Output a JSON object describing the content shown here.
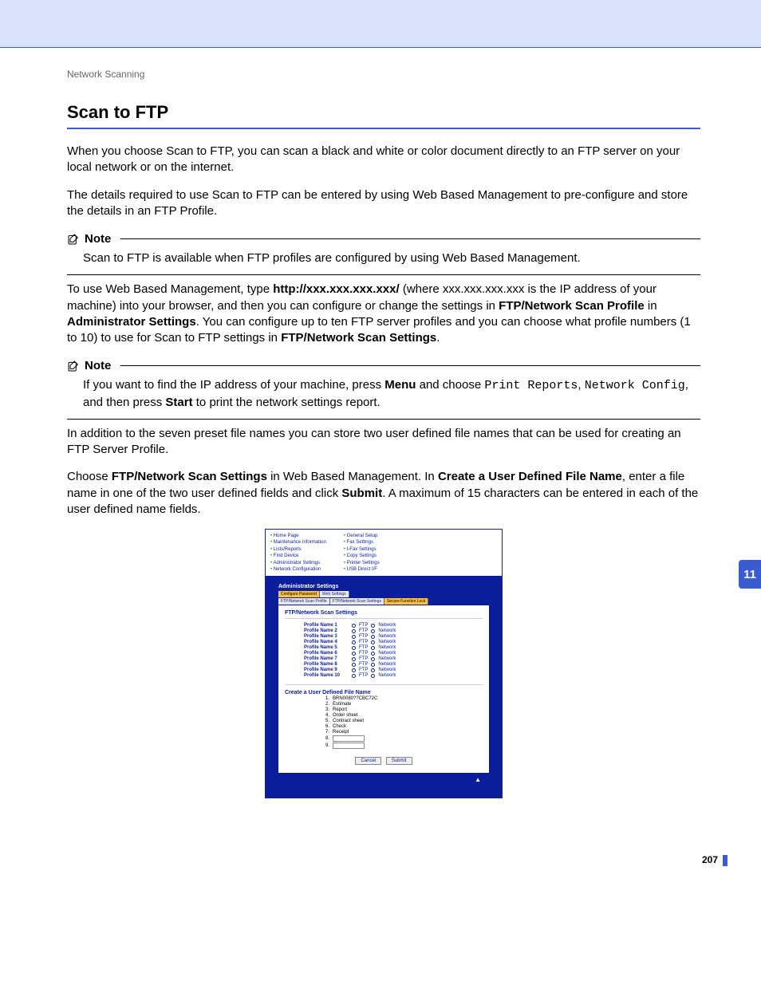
{
  "breadcrumb": "Network Scanning",
  "title": "Scan to FTP",
  "side_tab": "11",
  "page_number": "207",
  "p1": "When you choose Scan to FTP, you can scan a black and white or color document directly to an FTP server on your local network or on the internet.",
  "p2": "The details required to use Scan to FTP can be entered by using Web Based Management to pre-configure and store the details in an FTP Profile.",
  "note1": {
    "label": "Note",
    "body": "Scan to FTP is available when FTP profiles are configured by using Web Based Management."
  },
  "p3a": "To use Web Based Management, type ",
  "p3_url": "http://xxx.xxx.xxx.xxx/",
  "p3b": " (where xxx.xxx.xxx.xxx is the IP address of your machine) into your browser, and then you can configure or change the settings in ",
  "p3_b1": "FTP/Network Scan Profile",
  "p3c": " in ",
  "p3_b2": "Administrator Settings",
  "p3d": ". You can configure up to ten FTP server profiles and you can choose what profile numbers (1 to 10) to use for Scan to FTP settings in ",
  "p3_b3": "FTP/Network Scan Settings",
  "p3e": ".",
  "note2": {
    "label": "Note",
    "a": "If you want to find the IP address of your machine, press ",
    "menu": "Menu",
    "b": " and choose ",
    "c1": "Print Reports",
    "c": ", ",
    "c2": "Network Config",
    "d": ", and then press ",
    "start": "Start",
    "e": " to print the network settings report."
  },
  "p4": "In addition to the seven preset file names you can store two user defined file names that can be used for creating an FTP Server Profile.",
  "p5a": "Choose ",
  "p5_b1": "FTP/Network Scan Settings",
  "p5b": " in Web Based Management. In ",
  "p5_b2": "Create a User Defined File Name",
  "p5c": ", enter a file name in one of the two user defined fields and click ",
  "p5_b3": "Submit",
  "p5d": ". A maximum of 15 characters can be entered in each of the user defined name fields.",
  "shot": {
    "left_nav": [
      "Home Page",
      "Maintenance Information",
      "Lists/Reports",
      "Find Device",
      "Administrator Settings",
      "Network Configuration"
    ],
    "right_nav": [
      "General Setup",
      "Fax Settings",
      "I-Fax Settings",
      "Copy Settings",
      "Printer Settings",
      "USB Direct I/F"
    ],
    "admin_title": "Administrator Settings",
    "tabs_row1": [
      "Configure Password",
      "Web Settings"
    ],
    "tabs_row2": [
      "FTP/Network Scan Profile",
      "FTP/Network Scan Settings",
      "Secure Function Lock"
    ],
    "panel_title": "FTP/Network Scan Settings",
    "profiles": [
      "Profile Name 1",
      "Profile Name 2",
      "Profile Name 3",
      "Profile Name 4",
      "Profile Name 5",
      "Profile Name 6",
      "Profile Name 7",
      "Profile Name 8",
      "Profile Name 9",
      "Profile Name 10"
    ],
    "opt_ftp": "FTP",
    "opt_net": "Network",
    "udfn_title": "Create a User Defined File Name",
    "udfn": [
      "BRN0080??CBC72C",
      "Estimate",
      "Report",
      "Order sheet",
      "Contract sheet",
      "Check",
      "Receipt"
    ],
    "btn_cancel": "Cancel",
    "btn_submit": "Submit"
  }
}
